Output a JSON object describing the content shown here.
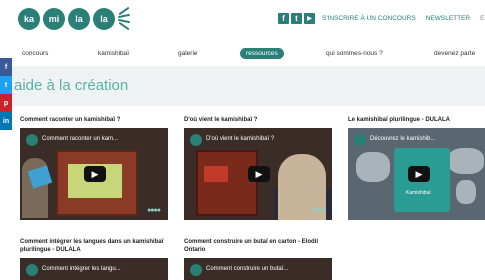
{
  "header": {
    "logo_syllables": [
      "ka",
      "mi",
      "la",
      "la"
    ],
    "social_icons": [
      "facebook-icon",
      "twitter-icon",
      "youtube-icon"
    ],
    "top_links": [
      "S'INSCRIRE À UN CONCOURS",
      "NEWSLETTER",
      "EN"
    ]
  },
  "nav": {
    "items": [
      "concours",
      "kamishibaï",
      "galerie",
      "ressources",
      "qui sommes-nous ?",
      "devenez parte"
    ],
    "active": "ressources"
  },
  "sidebar": {
    "icons": [
      "facebook-icon",
      "twitter-icon",
      "pinterest-icon",
      "linkedin-icon"
    ],
    "glyphs": [
      "f",
      "t",
      "p",
      "in"
    ]
  },
  "page": {
    "title": "aide à la création"
  },
  "videos": [
    {
      "title": "Comment raconter un kamishibaï ?",
      "overlay_title": "Comment raconter un kam..."
    },
    {
      "title": "D'où vient le kamishibaï ?",
      "overlay_title": "D'où vient le kamishibaï ?"
    },
    {
      "title": "Le kamishibaï plurilingue - DULALA",
      "overlay_title": "Découvrez le kamishib...",
      "card_label": "Kamishibaï"
    },
    {
      "title": "Comment intégrer les langues dans un kamishibaï plurilingue - DULALA",
      "overlay_title": "Comment intégrer les langu..."
    },
    {
      "title": "Comment construire un butaï en carton - Elodil Ontario",
      "overlay_title": "Comment construire un butaï..."
    }
  ],
  "colors": {
    "brand": "#2a7f77",
    "title": "#5bb0a8"
  }
}
